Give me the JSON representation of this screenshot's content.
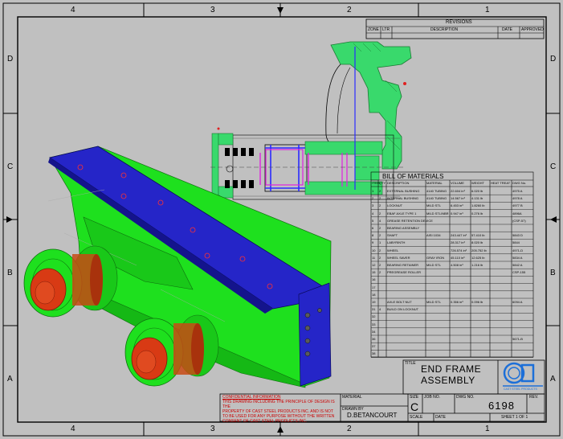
{
  "zones": {
    "columns": [
      "4",
      "3",
      "2",
      "1"
    ],
    "rows": [
      "D",
      "C",
      "B",
      "A"
    ]
  },
  "revisions": {
    "title": "REVISIONS",
    "headers": [
      "ZONE",
      "LTR",
      "DESCRIPTION",
      "DATE",
      "APPROVED"
    ]
  },
  "bom": {
    "title": "BILL OF MATERIALS",
    "headers": [
      "ITEM",
      "QTY",
      "DESCRIPTION",
      "MATERIAL",
      "VOLUME",
      "WEIGHT",
      "HEAT TREAT",
      "DWG No."
    ],
    "rows": [
      [
        "1",
        "2",
        "EXTERNAL BUSHING",
        "4140 TUBING",
        "22.604 in³",
        "6.020 lb",
        "",
        "4975 A"
      ],
      [
        "2",
        "2",
        "INTERNAL BUSHING",
        "4140 TUBING",
        "14.567 in³",
        "4.131 lb",
        "",
        "4978 A"
      ],
      [
        "3",
        "2",
        "LOCKNUT",
        "MILD STL",
        "6.453 in³",
        "1.8260 lb",
        "",
        "4977 B"
      ],
      [
        "4",
        "2",
        "EBAF AXLE TYPE 1",
        "MILD STL/NBR",
        "0.947 in³",
        "0.276 lb",
        "",
        "4896A"
      ],
      [
        "5",
        "4",
        "GREASE RETENTION DEVICE",
        "",
        "",
        "",
        "",
        "(CSP-57)"
      ],
      [
        "6",
        "2",
        "BEARING ASSEMBLY",
        "",
        "",
        "",
        "",
        ""
      ],
      [
        "8",
        "2",
        "SHAFT",
        "AISI 1034",
        "243.447 in³",
        "57.410 lb",
        "",
        "5843 D"
      ],
      [
        "9",
        "1",
        "LABYRINTH",
        "",
        "28.317 in³",
        "8.020 lb",
        "",
        "5844"
      ],
      [
        "10",
        "2",
        "WHEEL",
        "",
        "726.574 in³",
        "205.752 lb",
        "",
        "4971-D"
      ],
      [
        "11",
        "2",
        "WHEEL SAVER",
        "GRAY IRON",
        "45.110 in³",
        "12.625 lb",
        "",
        "5834 A"
      ],
      [
        "12",
        "2",
        "BEARING RETAINER",
        "MILD STL",
        "4.508 in³",
        "1.216 lb",
        "",
        "5842 A"
      ],
      [
        "15",
        "2",
        "PREGREASE ROLLER",
        "",
        "",
        "",
        "",
        "CSP-155"
      ],
      [
        "16",
        "",
        "",
        "",
        "",
        "",
        "",
        ""
      ],
      [
        "17",
        "",
        "",
        "",
        "",
        "",
        "",
        ""
      ],
      [
        "18",
        "",
        "",
        "",
        "",
        "",
        "",
        ""
      ],
      [
        "19",
        "",
        "AXLE BOLT NUT",
        "MILD STL",
        "0.356 in³",
        "0.096 lb",
        "",
        "6094 A"
      ],
      [
        "31",
        "4",
        "BUILD ON LOCKNUT",
        "",
        "",
        "",
        "",
        ""
      ],
      [
        "32",
        "",
        "",
        "",
        "",
        "",
        "",
        ""
      ],
      [
        "33",
        "",
        "",
        "",
        "",
        "",
        "",
        ""
      ],
      [
        "34",
        "",
        "",
        "",
        "",
        "",
        "",
        ""
      ],
      [
        "36",
        "",
        "",
        "",
        "",
        "",
        "",
        "5671-B"
      ],
      [
        "37",
        "",
        "",
        "",
        "",
        "",
        "",
        ""
      ],
      [
        "38",
        "",
        "",
        "",
        "",
        "",
        "",
        ""
      ]
    ]
  },
  "title_block": {
    "title_label": "TITLE",
    "title_line1": "END FRAME",
    "title_line2": "ASSEMBLY",
    "company": "CAST STEEL PRODUCTS",
    "logo_letters": "CSP",
    "confidential": [
      "CONFIDENTIAL INFORMATION",
      "THIS DRAWING INCLUDING THE PRINCIPLE OF DESIGN IS THE",
      "PROPERTY OF CAST STEEL PRODUCTS INC. AND IS NOT",
      "TO BE USED FOR ANY PURPOSE WITHOUT THE WRITTEN",
      "CONSENT OF CAST STEEL PRODUCTS INC."
    ],
    "material_label": "MATERIAL",
    "drawn_by_label": "DRAWN BY",
    "drawn_by": "D.BETANCOURT",
    "size_label": "SIZE",
    "size": "C",
    "job_label": "JOB NO.",
    "dwg_label": "DWG NO.",
    "dwg_no": "6198",
    "rev_label": "REV.",
    "scale_label": "SCALE",
    "date_label": "DATE",
    "sheet_text": "SHEET 1 OF 1"
  },
  "colors": {
    "sheet": "#c0c0c0",
    "frame_green": "#1ee01e",
    "plate_blue": "#2525c8",
    "wheel_red": "#d83a14",
    "section_green": "#39d96c",
    "confidential_red": "#cc0000",
    "logo_blue": "#1c6fd8"
  }
}
